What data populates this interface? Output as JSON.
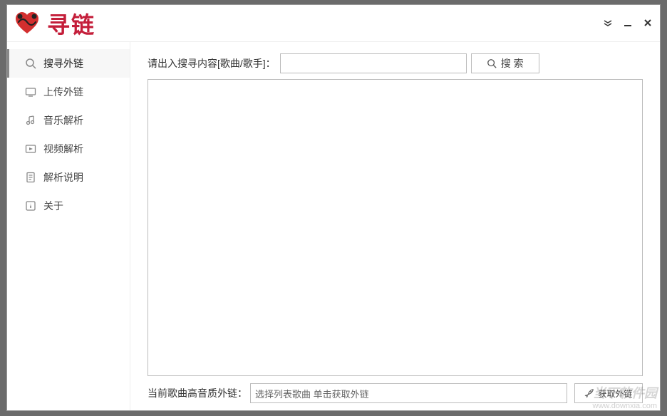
{
  "app": {
    "title": "寻链"
  },
  "sidebar": {
    "items": [
      {
        "icon": "search-icon",
        "label": "搜寻外链"
      },
      {
        "icon": "upload-icon",
        "label": "上传外链"
      },
      {
        "icon": "music-icon",
        "label": "音乐解析"
      },
      {
        "icon": "video-icon",
        "label": "视频解析"
      },
      {
        "icon": "doc-icon",
        "label": "解析说明"
      },
      {
        "icon": "about-icon",
        "label": "关于"
      }
    ]
  },
  "main": {
    "search_label": "请出入搜寻内容[歌曲/歌手]：",
    "search_value": "",
    "search_button": "搜 索",
    "bottom_label": "当前歌曲高音质外链：",
    "bottom_value": "选择列表歌曲 单击获取外链",
    "get_button": "获取外链"
  },
  "watermark": {
    "text": "当下软件园",
    "url": "www.downxia.com"
  }
}
